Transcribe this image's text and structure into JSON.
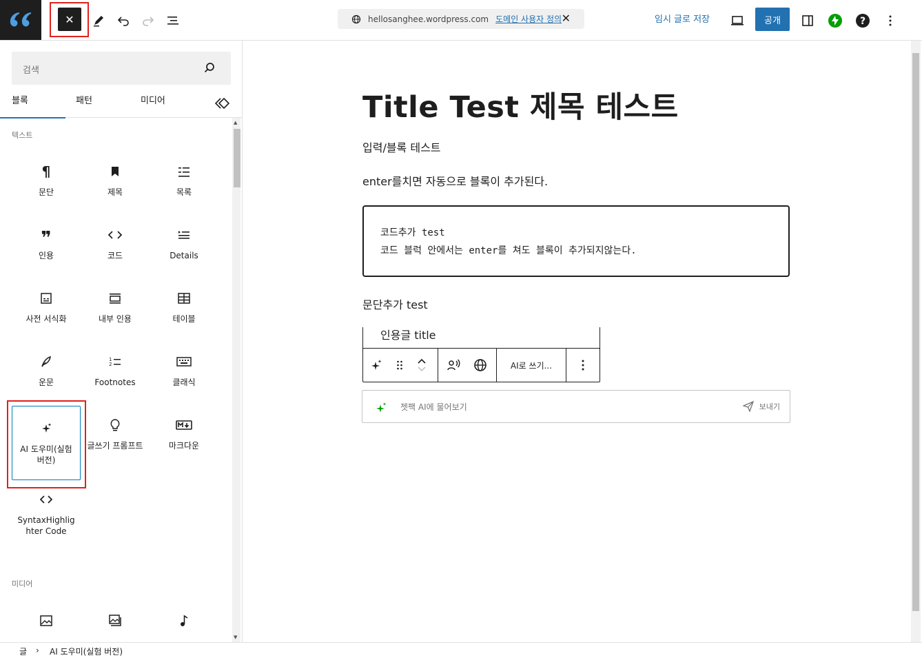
{
  "topbar": {
    "url": "hellosanghee.wordpress.com",
    "domain_link": "도메인 사용자 정의",
    "save_draft": "임시 글로 저장",
    "publish": "공개"
  },
  "inserter": {
    "search_placeholder": "검색",
    "tabs": [
      "블록",
      "패턴",
      "미디어"
    ],
    "sections": {
      "text": "텍스트",
      "media": "미디어"
    },
    "text_blocks": [
      {
        "label": "문단",
        "icon": "paragraph-icon"
      },
      {
        "label": "제목",
        "icon": "heading-bookmark-icon"
      },
      {
        "label": "목록",
        "icon": "list-icon"
      },
      {
        "label": "인용",
        "icon": "quote-icon"
      },
      {
        "label": "코드",
        "icon": "code-icon"
      },
      {
        "label": "Details",
        "icon": "details-icon"
      },
      {
        "label": "사전 서식화",
        "icon": "preformatted-icon"
      },
      {
        "label": "내부 인용",
        "icon": "pullquote-icon"
      },
      {
        "label": "테이블",
        "icon": "table-icon"
      },
      {
        "label": "운문",
        "icon": "verse-feather-icon"
      },
      {
        "label": "Footnotes",
        "icon": "footnotes-icon"
      },
      {
        "label": "클래식",
        "icon": "keyboard-icon"
      },
      {
        "label": "AI 도우미(실험 버전)",
        "icon": "sparkle-icon"
      },
      {
        "label": "글쓰기 프롬프트",
        "icon": "lightbulb-icon"
      },
      {
        "label": "마크다운",
        "icon": "markdown-icon"
      },
      {
        "label": "SyntaxHighlighter Code",
        "icon": "code-icon"
      }
    ]
  },
  "editor": {
    "title": "Title Test 제목 테스트",
    "para1": "입력/블록 테스트",
    "para2": "enter를치면 자동으로 블록이 추가된다.",
    "code_line1": "코드추가 test",
    "code_line2": "코드 블럭 안에서는 enter를 쳐도 블록이 추가되지않는다.",
    "para3": "문단추가 test",
    "quote": "인용글 title",
    "toolbar_ai_write": "AI로 쓰기...",
    "ai_placeholder": "젯팩 AI에 물어보기",
    "ai_send": "보내기"
  },
  "footer": {
    "crumb_root": "글",
    "crumb_current": "AI 도우미(실험 버전)"
  },
  "colors": {
    "accent": "#2271b1",
    "highlight": "#e0201b",
    "jetpack": "#069e08",
    "dark": "#1e1e1e"
  }
}
